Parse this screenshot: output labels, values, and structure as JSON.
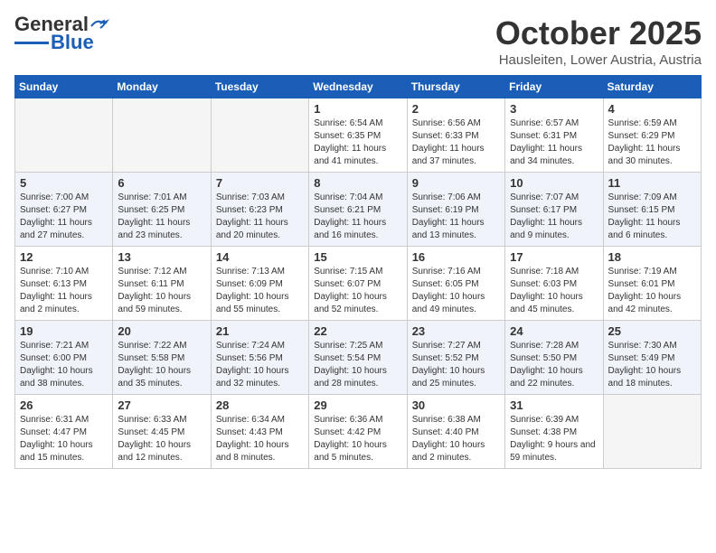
{
  "header": {
    "logo_general": "General",
    "logo_blue": "Blue",
    "month": "October 2025",
    "location": "Hausleiten, Lower Austria, Austria"
  },
  "weekdays": [
    "Sunday",
    "Monday",
    "Tuesday",
    "Wednesday",
    "Thursday",
    "Friday",
    "Saturday"
  ],
  "weeks": [
    [
      {
        "day": "",
        "sunrise": "",
        "sunset": "",
        "daylight": ""
      },
      {
        "day": "",
        "sunrise": "",
        "sunset": "",
        "daylight": ""
      },
      {
        "day": "",
        "sunrise": "",
        "sunset": "",
        "daylight": ""
      },
      {
        "day": "1",
        "sunrise": "Sunrise: 6:54 AM",
        "sunset": "Sunset: 6:35 PM",
        "daylight": "Daylight: 11 hours and 41 minutes."
      },
      {
        "day": "2",
        "sunrise": "Sunrise: 6:56 AM",
        "sunset": "Sunset: 6:33 PM",
        "daylight": "Daylight: 11 hours and 37 minutes."
      },
      {
        "day": "3",
        "sunrise": "Sunrise: 6:57 AM",
        "sunset": "Sunset: 6:31 PM",
        "daylight": "Daylight: 11 hours and 34 minutes."
      },
      {
        "day": "4",
        "sunrise": "Sunrise: 6:59 AM",
        "sunset": "Sunset: 6:29 PM",
        "daylight": "Daylight: 11 hours and 30 minutes."
      }
    ],
    [
      {
        "day": "5",
        "sunrise": "Sunrise: 7:00 AM",
        "sunset": "Sunset: 6:27 PM",
        "daylight": "Daylight: 11 hours and 27 minutes."
      },
      {
        "day": "6",
        "sunrise": "Sunrise: 7:01 AM",
        "sunset": "Sunset: 6:25 PM",
        "daylight": "Daylight: 11 hours and 23 minutes."
      },
      {
        "day": "7",
        "sunrise": "Sunrise: 7:03 AM",
        "sunset": "Sunset: 6:23 PM",
        "daylight": "Daylight: 11 hours and 20 minutes."
      },
      {
        "day": "8",
        "sunrise": "Sunrise: 7:04 AM",
        "sunset": "Sunset: 6:21 PM",
        "daylight": "Daylight: 11 hours and 16 minutes."
      },
      {
        "day": "9",
        "sunrise": "Sunrise: 7:06 AM",
        "sunset": "Sunset: 6:19 PM",
        "daylight": "Daylight: 11 hours and 13 minutes."
      },
      {
        "day": "10",
        "sunrise": "Sunrise: 7:07 AM",
        "sunset": "Sunset: 6:17 PM",
        "daylight": "Daylight: 11 hours and 9 minutes."
      },
      {
        "day": "11",
        "sunrise": "Sunrise: 7:09 AM",
        "sunset": "Sunset: 6:15 PM",
        "daylight": "Daylight: 11 hours and 6 minutes."
      }
    ],
    [
      {
        "day": "12",
        "sunrise": "Sunrise: 7:10 AM",
        "sunset": "Sunset: 6:13 PM",
        "daylight": "Daylight: 11 hours and 2 minutes."
      },
      {
        "day": "13",
        "sunrise": "Sunrise: 7:12 AM",
        "sunset": "Sunset: 6:11 PM",
        "daylight": "Daylight: 10 hours and 59 minutes."
      },
      {
        "day": "14",
        "sunrise": "Sunrise: 7:13 AM",
        "sunset": "Sunset: 6:09 PM",
        "daylight": "Daylight: 10 hours and 55 minutes."
      },
      {
        "day": "15",
        "sunrise": "Sunrise: 7:15 AM",
        "sunset": "Sunset: 6:07 PM",
        "daylight": "Daylight: 10 hours and 52 minutes."
      },
      {
        "day": "16",
        "sunrise": "Sunrise: 7:16 AM",
        "sunset": "Sunset: 6:05 PM",
        "daylight": "Daylight: 10 hours and 49 minutes."
      },
      {
        "day": "17",
        "sunrise": "Sunrise: 7:18 AM",
        "sunset": "Sunset: 6:03 PM",
        "daylight": "Daylight: 10 hours and 45 minutes."
      },
      {
        "day": "18",
        "sunrise": "Sunrise: 7:19 AM",
        "sunset": "Sunset: 6:01 PM",
        "daylight": "Daylight: 10 hours and 42 minutes."
      }
    ],
    [
      {
        "day": "19",
        "sunrise": "Sunrise: 7:21 AM",
        "sunset": "Sunset: 6:00 PM",
        "daylight": "Daylight: 10 hours and 38 minutes."
      },
      {
        "day": "20",
        "sunrise": "Sunrise: 7:22 AM",
        "sunset": "Sunset: 5:58 PM",
        "daylight": "Daylight: 10 hours and 35 minutes."
      },
      {
        "day": "21",
        "sunrise": "Sunrise: 7:24 AM",
        "sunset": "Sunset: 5:56 PM",
        "daylight": "Daylight: 10 hours and 32 minutes."
      },
      {
        "day": "22",
        "sunrise": "Sunrise: 7:25 AM",
        "sunset": "Sunset: 5:54 PM",
        "daylight": "Daylight: 10 hours and 28 minutes."
      },
      {
        "day": "23",
        "sunrise": "Sunrise: 7:27 AM",
        "sunset": "Sunset: 5:52 PM",
        "daylight": "Daylight: 10 hours and 25 minutes."
      },
      {
        "day": "24",
        "sunrise": "Sunrise: 7:28 AM",
        "sunset": "Sunset: 5:50 PM",
        "daylight": "Daylight: 10 hours and 22 minutes."
      },
      {
        "day": "25",
        "sunrise": "Sunrise: 7:30 AM",
        "sunset": "Sunset: 5:49 PM",
        "daylight": "Daylight: 10 hours and 18 minutes."
      }
    ],
    [
      {
        "day": "26",
        "sunrise": "Sunrise: 6:31 AM",
        "sunset": "Sunset: 4:47 PM",
        "daylight": "Daylight: 10 hours and 15 minutes."
      },
      {
        "day": "27",
        "sunrise": "Sunrise: 6:33 AM",
        "sunset": "Sunset: 4:45 PM",
        "daylight": "Daylight: 10 hours and 12 minutes."
      },
      {
        "day": "28",
        "sunrise": "Sunrise: 6:34 AM",
        "sunset": "Sunset: 4:43 PM",
        "daylight": "Daylight: 10 hours and 8 minutes."
      },
      {
        "day": "29",
        "sunrise": "Sunrise: 6:36 AM",
        "sunset": "Sunset: 4:42 PM",
        "daylight": "Daylight: 10 hours and 5 minutes."
      },
      {
        "day": "30",
        "sunrise": "Sunrise: 6:38 AM",
        "sunset": "Sunset: 4:40 PM",
        "daylight": "Daylight: 10 hours and 2 minutes."
      },
      {
        "day": "31",
        "sunrise": "Sunrise: 6:39 AM",
        "sunset": "Sunset: 4:38 PM",
        "daylight": "Daylight: 9 hours and 59 minutes."
      },
      {
        "day": "",
        "sunrise": "",
        "sunset": "",
        "daylight": ""
      }
    ]
  ]
}
